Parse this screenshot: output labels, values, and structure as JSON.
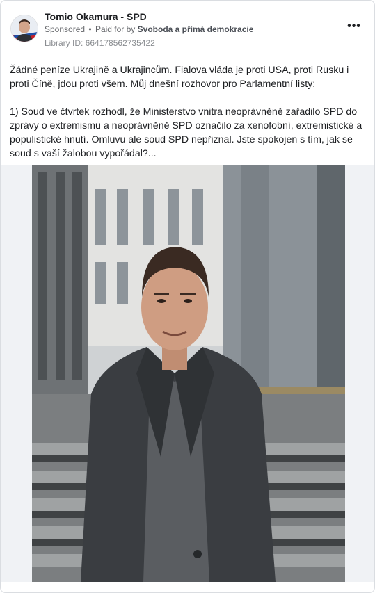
{
  "header": {
    "page_name": "Tomio Okamura - SPD",
    "sponsored": "Sponsored",
    "separator": "•",
    "paid_for_by": "Paid for by",
    "sponsor": "Svoboda a přímá demokracie",
    "library_id": "Library ID: 664178562735422",
    "more_icon": "more-horizontal-icon",
    "more_label": "•••"
  },
  "post": {
    "paragraph1": "Žádné peníze Ukrajině a Ukrajincům. Fialova vláda je proti USA, proti Rusku i proti Číně, jdou proti všem. Můj dnešní rozhovor pro Parlamentní listy:",
    "paragraph2": "1) Soud ve čtvrtek rozhodl, že Ministerstvo vnitra neoprávněně zařadilo SPD do zprávy o extremismu a neoprávněně SPD označilo za xenofobní, extremistické a populistické hnutí. Omluvu ale soud SPD nepřiznal. Jste spokojen s tím, jak se soud s vaší žalobou vypořádal?..."
  },
  "colors": {
    "text": "#1c1e21",
    "meta": "#65676b",
    "border": "#dadde1",
    "media_bg": "#f0f2f5"
  }
}
